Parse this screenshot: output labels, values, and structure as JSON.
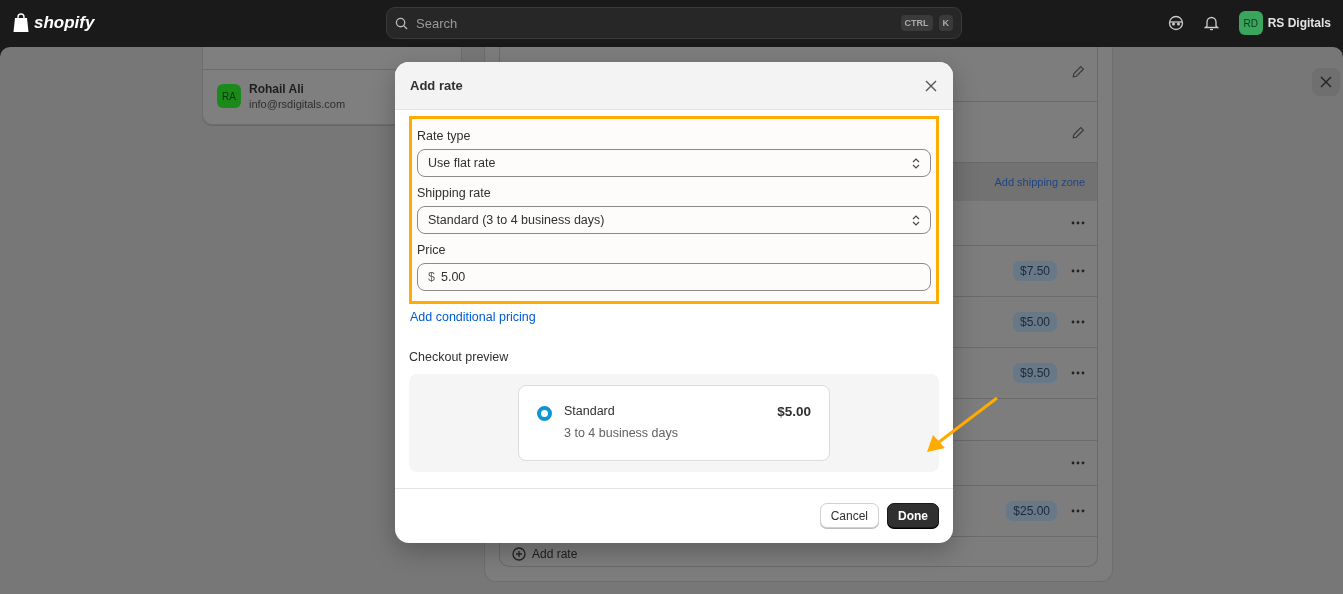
{
  "top_bar": {
    "logo": "shopify",
    "search": {
      "placeholder": "Search",
      "keys": [
        "CTRL",
        "K"
      ]
    },
    "account": {
      "initials": "RD",
      "name": "RS Digitals"
    }
  },
  "sidebar_card": {
    "user": {
      "initials": "RA",
      "name": "Rohail Ali",
      "email": "info@rsdigitals.com"
    }
  },
  "shipping_panel": {
    "rows": [
      {
        "kind": "edit"
      },
      {
        "kind": "edit"
      },
      {
        "kind": "header",
        "link": "Add shipping zone"
      },
      {
        "kind": "menu"
      },
      {
        "kind": "price",
        "price": "$7.50"
      },
      {
        "kind": "price",
        "price": "$5.00"
      },
      {
        "kind": "price",
        "price": "$9.50"
      },
      {
        "kind": "blank"
      },
      {
        "kind": "menu"
      },
      {
        "kind": "price",
        "price": "$25.00"
      }
    ],
    "add_rate": "Add rate"
  },
  "modal": {
    "title": "Add rate",
    "fields": [
      {
        "kind": "select",
        "label": "Rate type",
        "value": "Use flat rate"
      },
      {
        "kind": "select",
        "label": "Shipping rate",
        "value": "Standard (3 to 4 business days)"
      },
      {
        "kind": "currency",
        "label": "Price",
        "prefix": "$",
        "value": "5.00"
      }
    ],
    "link": "Add conditional pricing",
    "preview": {
      "label": "Checkout preview",
      "option": {
        "selected": true,
        "name": "Standard",
        "detail": "3 to 4 business days",
        "price": "$5.00"
      }
    },
    "buttons": [
      {
        "kind": "secondary",
        "label": "Cancel"
      },
      {
        "kind": "primary",
        "label": "Done"
      }
    ]
  },
  "annotations": {
    "highlight_frame": true,
    "arrow": true
  }
}
